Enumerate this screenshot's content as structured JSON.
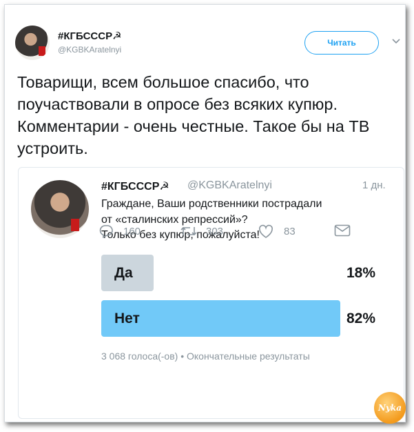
{
  "header": {
    "name": "#КГБСССР☭",
    "handle": "@KGBKAratelnyi",
    "follow_label": "Читать"
  },
  "tweet_text": "Товарищи, всем большое спасибо, что поучаствовали в опросе без всяких купюр. Комментарии - очень честные. Такое бы на ТВ устроить.",
  "quoted": {
    "name": "#КГБСССР☭",
    "handle": "@KGBKAratelnyi",
    "time": "1 дн.",
    "text_lines": [
      "Граждане, Ваши родственники пострадали",
      "от «сталинских репрессий»?",
      "Только без купюр, пожалуйста!"
    ],
    "poll": {
      "options": [
        {
          "label": "Да",
          "percent": "18%",
          "fraction": 0.18,
          "color": "#ccd6dd"
        },
        {
          "label": "Нет",
          "percent": "82%",
          "fraction": 0.82,
          "color": "#71c9f8"
        }
      ],
      "meta": "3 068 голоса(-ов) • Окончательные результаты"
    }
  },
  "actions": {
    "replies": "160",
    "retweets": "303",
    "likes": "83"
  },
  "watermark_text": "Nyka",
  "colors": {
    "accent": "#1da1f2",
    "muted": "#8a959d",
    "poll_selected": "#71c9f8",
    "poll_other": "#ccd6dd"
  }
}
